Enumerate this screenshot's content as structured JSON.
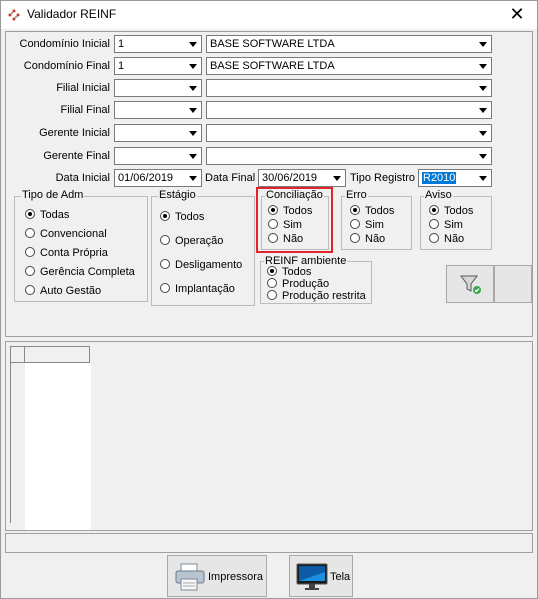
{
  "window": {
    "title": "Validador REINF",
    "close": "✕"
  },
  "filters": {
    "condominio_inicial": {
      "label": "Condomínio Inicial",
      "code": "1",
      "name": "BASE SOFTWARE LTDA"
    },
    "condominio_final": {
      "label": "Condomínio Final",
      "code": "1",
      "name": "BASE SOFTWARE LTDA"
    },
    "filial_inicial": {
      "label": "Filial Inicial",
      "code": "",
      "name": ""
    },
    "filial_final": {
      "label": "Filial Final",
      "code": "",
      "name": ""
    },
    "gerente_inicial": {
      "label": "Gerente Inicial",
      "code": "",
      "name": ""
    },
    "gerente_final": {
      "label": "Gerente Final",
      "code": "",
      "name": ""
    },
    "data_inicial": {
      "label": "Data Inicial",
      "value": "01/06/2019"
    },
    "data_final": {
      "label": "Data Final",
      "value": "30/06/2019"
    },
    "tipo_registro": {
      "label": "Tipo Registro",
      "value": "R2010"
    }
  },
  "groups": {
    "tipo_adm": {
      "title": "Tipo de Adm",
      "options": [
        "Todas",
        "Convencional",
        "Conta Própria",
        "Gerência Completa",
        "Auto Gestão"
      ],
      "selected": 0
    },
    "estagio": {
      "title": "Estágio",
      "options": [
        "Todos",
        "Operação",
        "Desligamento",
        "Implantação"
      ],
      "selected": 0
    },
    "conciliacao": {
      "title": "Conciliação",
      "options": [
        "Todos",
        "Sim",
        "Não"
      ],
      "selected": 0
    },
    "erro": {
      "title": "Erro",
      "options": [
        "Todos",
        "Sim",
        "Não"
      ],
      "selected": 0
    },
    "aviso": {
      "title": "Aviso",
      "options": [
        "Todos",
        "Sim",
        "Não"
      ],
      "selected": 0
    },
    "reinf_ambiente": {
      "title": "REINF ambiente",
      "options": [
        "Todos",
        "Produção",
        "Produção restrita"
      ],
      "selected": 0
    }
  },
  "buttons": {
    "impressora": "Impressora",
    "tela": "Tela"
  },
  "icons": {
    "app": "reinf-app-icon",
    "filter": "filter-icon",
    "printer": "printer-icon",
    "monitor": "monitor-icon"
  },
  "colors": {
    "highlight": "#e0252f",
    "selection": "#0078d7"
  }
}
